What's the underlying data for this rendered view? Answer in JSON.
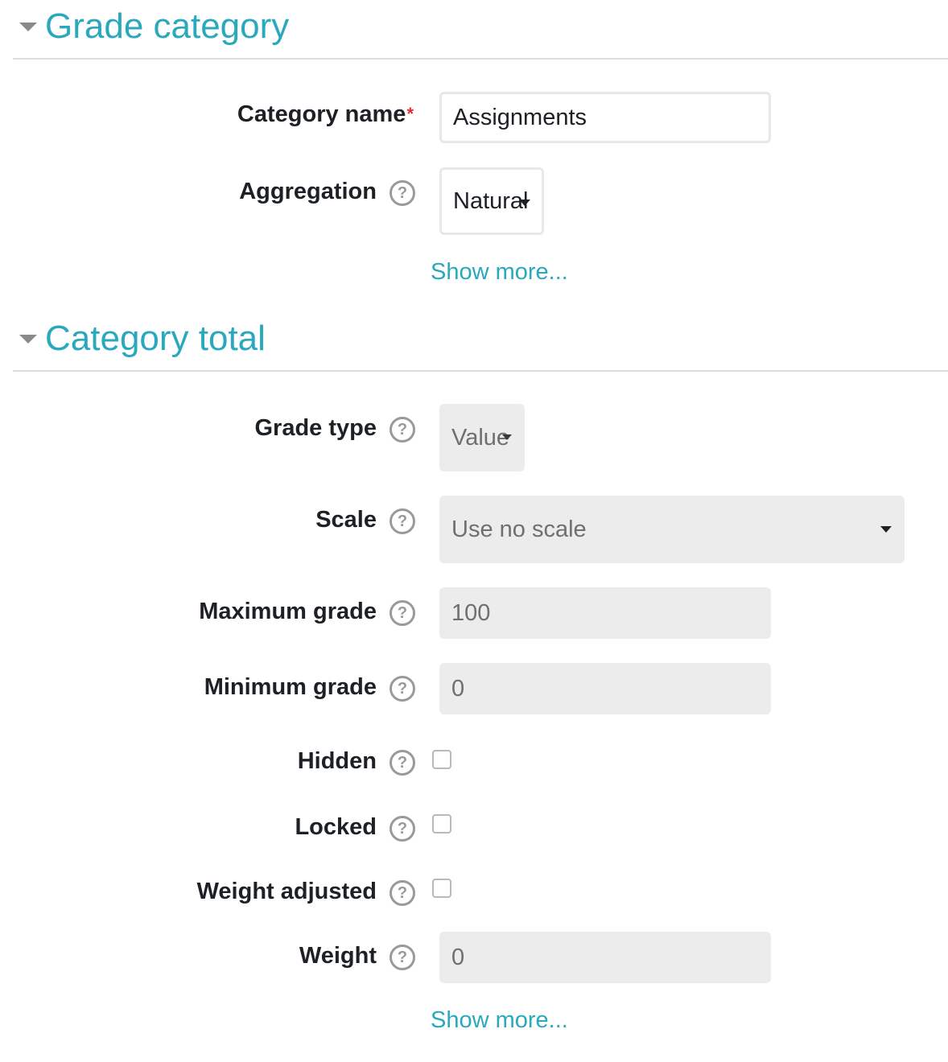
{
  "sections": {
    "grade_category": {
      "title": "Grade category",
      "fields": {
        "category_name": {
          "label": "Category name",
          "required_mark": "*",
          "value": "Assignments"
        },
        "aggregation": {
          "label": "Aggregation",
          "value": "Natural"
        }
      },
      "show_more": "Show more..."
    },
    "category_total": {
      "title": "Category total",
      "fields": {
        "grade_type": {
          "label": "Grade type",
          "value": "Value"
        },
        "scale": {
          "label": "Scale",
          "value": "Use no scale"
        },
        "maximum_grade": {
          "label": "Maximum grade",
          "value": "100"
        },
        "minimum_grade": {
          "label": "Minimum grade",
          "value": "0"
        },
        "hidden": {
          "label": "Hidden",
          "checked": false
        },
        "locked": {
          "label": "Locked",
          "checked": false
        },
        "weight_adjusted": {
          "label": "Weight adjusted",
          "checked": false
        },
        "weight": {
          "label": "Weight",
          "value": "0"
        }
      },
      "show_more": "Show more..."
    }
  },
  "help_icon_glyph": "?",
  "colors": {
    "link": "#2aa9bd",
    "required": "#e52d2d",
    "disabled_bg": "#ececec"
  }
}
